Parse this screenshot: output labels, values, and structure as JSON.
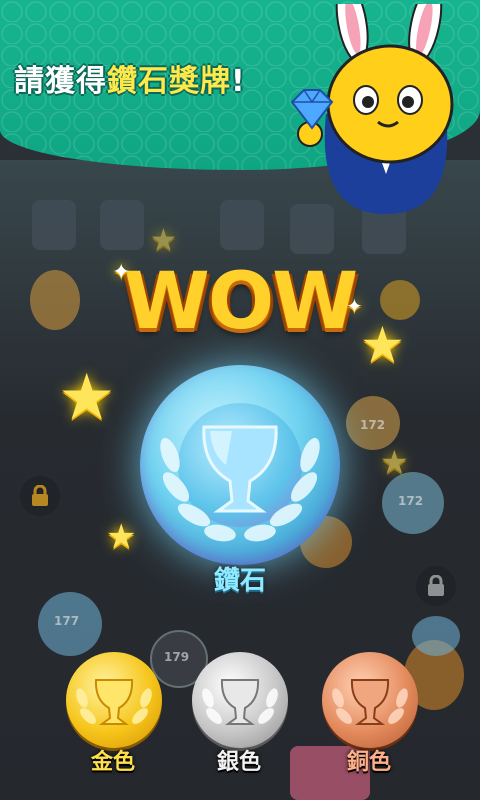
{
  "banner": {
    "prefix": "請獲得",
    "highlight": "鑽石獎牌",
    "suffix": "!"
  },
  "wow_text": "WOW",
  "main_medal": {
    "label": "鑽石",
    "color": "#8fe9ff"
  },
  "medals": [
    {
      "label": "金色",
      "color": "#ffe04a"
    },
    {
      "label": "銀色",
      "color": "#f2f2f2"
    },
    {
      "label": "銅色",
      "color": "#ffb088"
    }
  ],
  "background_levels": [
    "172",
    "179",
    "172",
    "177"
  ],
  "mascot": {
    "icon": "rabbit-mascot-icon",
    "holding": "diamond-icon"
  }
}
